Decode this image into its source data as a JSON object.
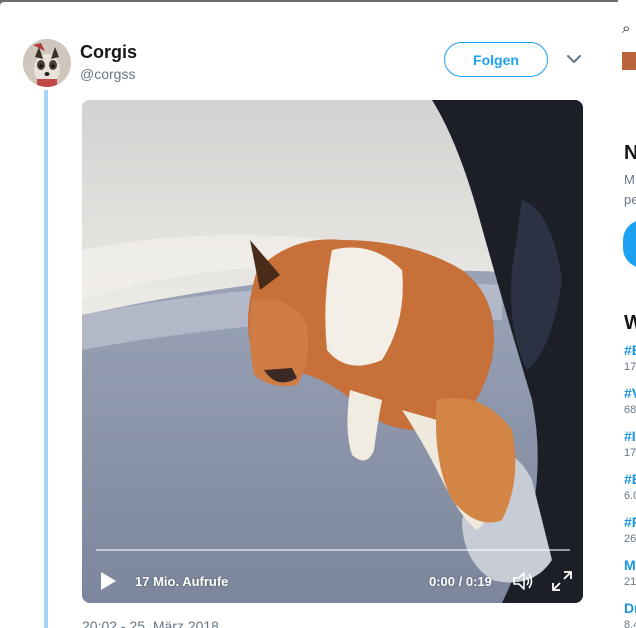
{
  "tweet": {
    "author_name": "Corgis",
    "author_handle": "@corgss",
    "follow_label": "Folgen",
    "timestamp": "20:02 - 25. März 2018"
  },
  "video": {
    "views_label": "17 Mio. Aufrufe",
    "time_display": "0:00 / 0:19",
    "progress_fraction": 0
  },
  "sidebar_peek": {
    "letters": [
      "N",
      "M",
      "pe",
      "W"
    ],
    "hashtags": [
      "#E",
      "#V",
      "#I",
      "#E",
      "#F"
    ],
    "counts": [
      "17",
      "68",
      "17",
      "6.0",
      "26"
    ],
    "tail_letters": [
      "M",
      "21",
      "Dr",
      "8.4"
    ]
  },
  "colors": {
    "accent": "#1da1f2",
    "thread_line": "#a6d4f2",
    "text_primary": "#14171a",
    "text_secondary": "#657786",
    "backdrop": "#6f6f6f"
  },
  "icons": [
    "chevron-down-icon",
    "play-icon",
    "volume-icon",
    "fullscreen-icon",
    "search-icon"
  ]
}
